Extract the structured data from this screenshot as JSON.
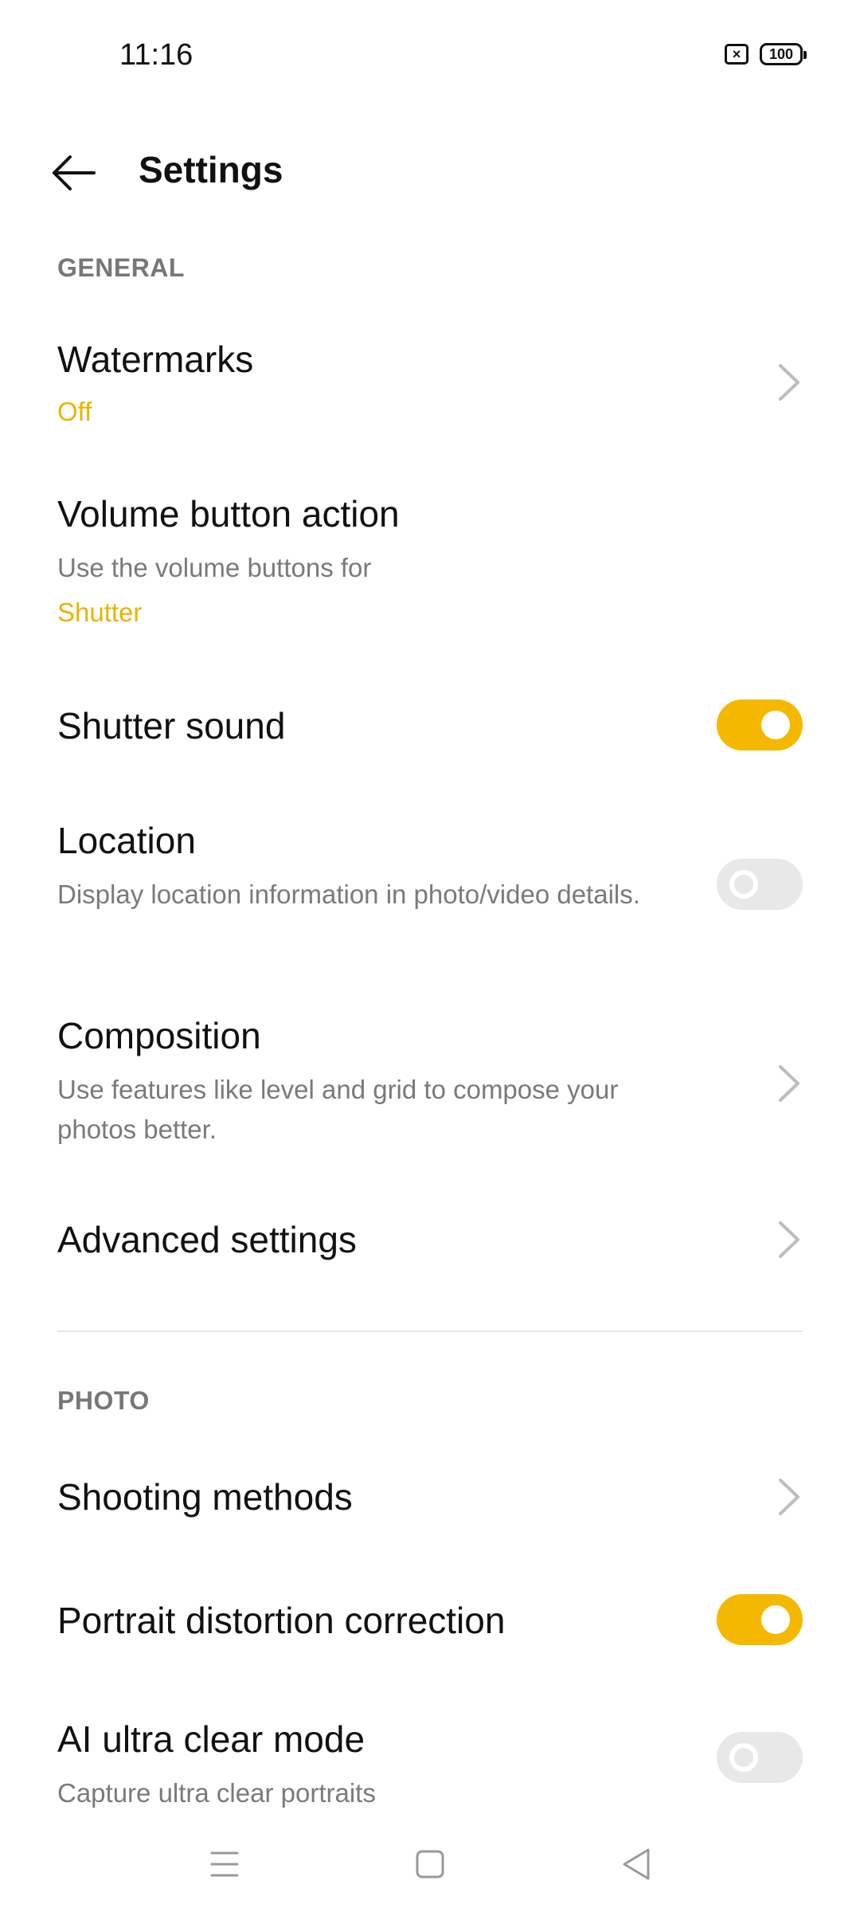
{
  "status_bar": {
    "time": "11:16",
    "sim_icon": "sim-x-icon",
    "battery_level": "100"
  },
  "app_bar": {
    "title": "Settings",
    "back_icon": "arrow-left-icon"
  },
  "sections": {
    "general": {
      "header": "GENERAL",
      "watermarks": {
        "title": "Watermarks",
        "value": "Off"
      },
      "volume_button": {
        "title": "Volume button action",
        "subtitle": "Use the volume buttons for",
        "value": "Shutter"
      },
      "shutter_sound": {
        "title": "Shutter sound",
        "enabled": true
      },
      "location": {
        "title": "Location",
        "subtitle": "Display location information in photo/video details.",
        "enabled": false
      },
      "composition": {
        "title": "Composition",
        "subtitle": "Use features like level and grid to compose your photos better."
      },
      "advanced": {
        "title": "Advanced settings"
      }
    },
    "photo": {
      "header": "PHOTO",
      "shooting_methods": {
        "title": "Shooting methods"
      },
      "portrait_distortion": {
        "title": "Portrait distortion correction",
        "enabled": true
      },
      "ai_ultra_clear": {
        "title": "AI ultra clear mode",
        "subtitle": "Capture ultra clear portraits",
        "enabled": false
      }
    }
  },
  "colors": {
    "accent": "#f5b800",
    "value_text": "#e8b400",
    "toggle_off": "#e8e8e8",
    "secondary_text": "#7a7a7a",
    "section_header": "#777777"
  },
  "nav_bar": {
    "menu_icon": "menu-icon",
    "home_icon": "home-square-icon",
    "back_icon": "back-triangle-icon"
  }
}
